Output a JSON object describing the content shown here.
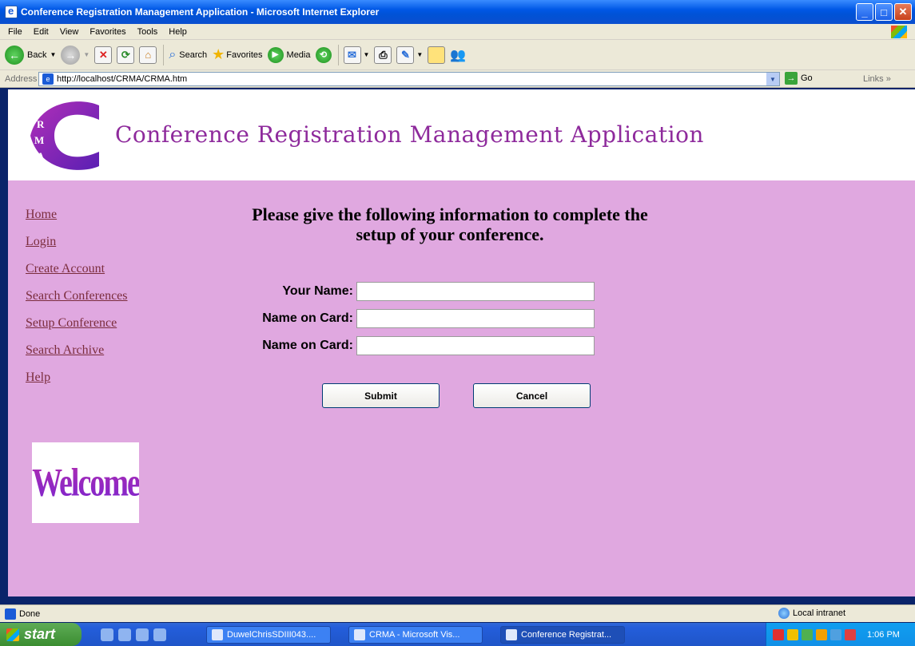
{
  "window": {
    "title": "Conference Registration Management Application - Microsoft Internet Explorer"
  },
  "menu": [
    "File",
    "Edit",
    "View",
    "Favorites",
    "Tools",
    "Help"
  ],
  "toolbar": {
    "back": "Back",
    "search": "Search",
    "favorites": "Favorites",
    "media": "Media"
  },
  "address": {
    "label": "Address",
    "url": "http://localhost/CRMA/CRMA.htm",
    "go": "Go",
    "links": "Links"
  },
  "banner": {
    "logo_letters": [
      "R",
      "M",
      "A"
    ],
    "title": "Conference Registration Management Application"
  },
  "nav": [
    "Home",
    "Login",
    "Create Account",
    "Search Conferences",
    "Setup Conference",
    "Search Archive",
    "Help"
  ],
  "welcome_image_text": "Welcome",
  "form": {
    "heading_line1": "Please give the following information to complete the",
    "heading_line2": "setup of your conference.",
    "fields": [
      {
        "label": "Your Name:",
        "value": ""
      },
      {
        "label": "Name on Card:",
        "value": ""
      },
      {
        "label": "Name on Card:",
        "value": ""
      }
    ],
    "submit_label": "Submit",
    "cancel_label": "Cancel"
  },
  "status": {
    "text": "Done",
    "zone": "Local intranet"
  },
  "taskbar": {
    "start": "start",
    "tasks": [
      "DuwelChrisSDIII043....",
      "CRMA - Microsoft Vis...",
      "Conference Registrat..."
    ],
    "clock": "1:06 PM"
  },
  "colors": {
    "page_bg": "#e0a8e0",
    "title_purple": "#8e2a9c",
    "nav_link": "#7b2d3d"
  }
}
